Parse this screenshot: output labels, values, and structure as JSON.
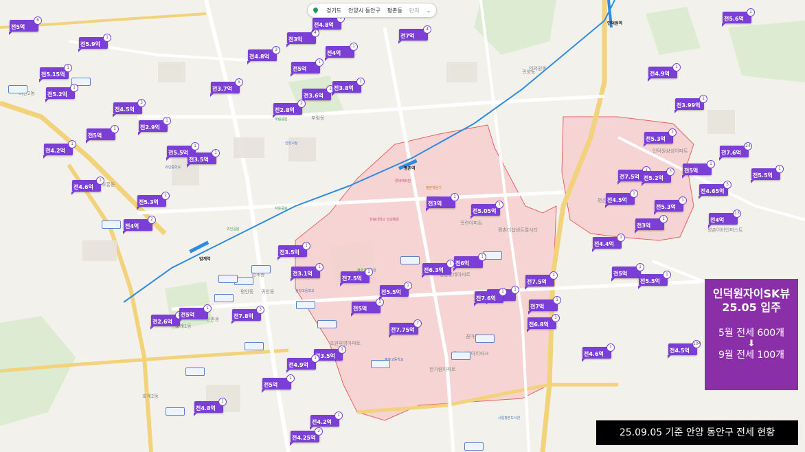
{
  "breadcrumb": {
    "region": "경기도",
    "district": "안양시 동안구",
    "dong": "평촌동",
    "extra": "단지"
  },
  "highlight_title": "인덕원자이SK뷰",
  "highlight_move_in": "25.05 입주",
  "highlight_may": "5월 전세 600개",
  "highlight_arrow": "⬇",
  "highlight_sep": "9월 전세 100개",
  "caption": "25.09.05 기준 안양 동안구 전세 현황",
  "colors": {
    "card": "#7b3fd6",
    "zone": "#f5c9c9",
    "zone_border": "#e24a4a",
    "info_box": "#8b2fa8",
    "rail": "#2e8ce0"
  },
  "listings": [
    {
      "p": "전5억",
      "n": "6"
    },
    {
      "p": "전5.9억",
      "n": "1"
    },
    {
      "p": "전5.15억",
      "n": "1"
    },
    {
      "p": "전5.2억",
      "n": "1"
    },
    {
      "p": "전4.8억",
      "n": "3"
    },
    {
      "p": "전3억",
      "n": "4"
    },
    {
      "p": "전4.8억",
      "n": "1"
    },
    {
      "p": "전4억",
      "n": "1"
    },
    {
      "p": "전5억",
      "n": "1"
    },
    {
      "p": "전3.7억",
      "n": "5"
    },
    {
      "p": "전7억",
      "n": "4"
    },
    {
      "p": "전3.6억",
      "n": "1"
    },
    {
      "p": "전3.8억",
      "n": "1"
    },
    {
      "p": "전2.8억",
      "n": "2"
    },
    {
      "p": "전4.5억",
      "n": "3"
    },
    {
      "p": "전2.9억",
      "n": "1"
    },
    {
      "p": "전5억",
      "n": "1"
    },
    {
      "p": "전4.2억",
      "n": "1"
    },
    {
      "p": "전5.5억",
      "n": "1"
    },
    {
      "p": "전3.5억",
      "n": "1"
    },
    {
      "p": "전4.6억",
      "n": "1"
    },
    {
      "p": "전5.3억",
      "n": "2"
    },
    {
      "p": "전4억",
      "n": "2"
    },
    {
      "p": "전5.6억",
      "n": "1"
    },
    {
      "p": "전4.9억",
      "n": "1"
    },
    {
      "p": "전3.99억",
      "n": "1"
    },
    {
      "p": "전5.3억",
      "n": "1"
    },
    {
      "p": "전7.6억",
      "n": "24"
    },
    {
      "p": "전5억",
      "n": "1"
    },
    {
      "p": "전7.5억",
      "n": "1"
    },
    {
      "p": "전5.2억",
      "n": "3"
    },
    {
      "p": "전5.5억",
      "n": "1"
    },
    {
      "p": "전4.65억",
      "n": "3"
    },
    {
      "p": "전4.5억",
      "n": "1"
    },
    {
      "p": "전5.3억",
      "n": "1"
    },
    {
      "p": "전3억",
      "n": "1"
    },
    {
      "p": "전5.05억",
      "n": "1"
    },
    {
      "p": "전4억",
      "n": "13"
    },
    {
      "p": "전4.4억",
      "n": "1"
    },
    {
      "p": "전3억",
      "n": "1"
    },
    {
      "p": "전3.5억",
      "n": "1"
    },
    {
      "p": "전3.1억",
      "n": "1"
    },
    {
      "p": "전7.5억",
      "n": "1"
    },
    {
      "p": "전6.3억",
      "n": "1"
    },
    {
      "p": "전6억",
      "n": "1"
    },
    {
      "p": "전5억",
      "n": "1"
    },
    {
      "p": "전5.5억",
      "n": "1"
    },
    {
      "p": "전6억",
      "n": "1"
    },
    {
      "p": "전5억",
      "n": "1"
    },
    {
      "p": "전7.8억",
      "n": "3"
    },
    {
      "p": "전7.5억",
      "n": "1"
    },
    {
      "p": "전5.5억",
      "n": "1"
    },
    {
      "p": "전7.6억",
      "n": "1"
    },
    {
      "p": "전7억",
      "n": "1"
    },
    {
      "p": "전2.6억",
      "n": "1"
    },
    {
      "p": "전5억",
      "n": "1"
    },
    {
      "p": "전6.8억",
      "n": "1"
    },
    {
      "p": "전7.75억",
      "n": "7"
    },
    {
      "p": "전3.5억",
      "n": "1"
    },
    {
      "p": "전4.9억",
      "n": "1"
    },
    {
      "p": "전4.6억",
      "n": "1"
    },
    {
      "p": "전4.5억",
      "n": "104"
    },
    {
      "p": "전5억",
      "n": "1"
    },
    {
      "p": "전4.8억",
      "n": "1"
    },
    {
      "p": "전4.2억",
      "n": "1"
    },
    {
      "p": "전4.25억",
      "n": "2"
    }
  ],
  "places": [
    "평촌역",
    "범계역",
    "인덕원역",
    "부림동",
    "평안동",
    "비산2동",
    "호계2동",
    "귀인동",
    "평촌동",
    "범계동",
    "부흥동",
    "호계1동",
    "관양동",
    "신촌동",
    "평촌중앙공원",
    "평촌공원",
    "자유공원",
    "한림대학교 성심병원",
    "인덕원동",
    "관양고등학교",
    "평촌학원가",
    "안양시청",
    "귀인중학교",
    "평촌고등학교",
    "한가람아파트",
    "부림공원",
    "귀인공원",
    "시립평촌도서관",
    "롯데백화점",
    "평촌자이아이파크",
    "목련아파트",
    "향촌롯데아파트",
    "초원부영아파트",
    "꿈마을",
    "평촌더샵센트럴시티",
    "인덕원삼성아파트",
    "평촌어바인퍼스트"
  ]
}
